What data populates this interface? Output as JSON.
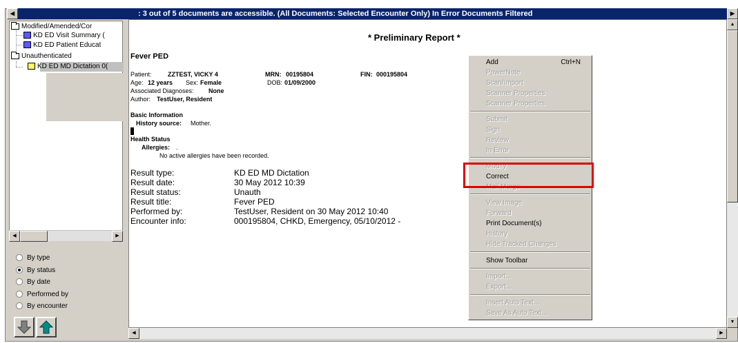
{
  "titlebar": {
    "text": ": 3 out of 5 documents are accessible.  (All Documents: Selected Encounter Only)  In Error Documents Filtered",
    "left_arrow": "◀",
    "right_arrow": "▶"
  },
  "tree": {
    "items": [
      {
        "label": "Modified/Amended/Cor",
        "type": "folder"
      },
      {
        "label": "KD ED Visit Summary (",
        "type": "document"
      },
      {
        "label": "KD ED Patient Educat",
        "type": "document"
      },
      {
        "label": "Unauthenticated",
        "type": "folder"
      },
      {
        "label": "KD ED MD Dictation 0(",
        "type": "document",
        "selected": true
      }
    ]
  },
  "sort_options": {
    "items": [
      {
        "label": "By type",
        "checked": false
      },
      {
        "label": "By status",
        "checked": true
      },
      {
        "label": "By date",
        "checked": false
      },
      {
        "label": "Performed by",
        "checked": false
      },
      {
        "label": "By encounter",
        "checked": false
      }
    ]
  },
  "nav": {
    "down_icon": "down-arrow-icon",
    "up_icon": "up-arrow-icon",
    "down_color": "#808080",
    "up_color": "#008b8b"
  },
  "document": {
    "heading": "* Preliminary Report *",
    "title": "Fever PED",
    "patient_label": "Patient:",
    "patient_value": "ZZTEST, VICKY 4",
    "mrn_label": "MRN:",
    "mrn_value": "00195804",
    "fin_label": "FIN:",
    "fin_value": "000195804",
    "age_label": "Age:",
    "age_value": "12 years",
    "sex_label": "Sex:",
    "sex_value": "Female",
    "dob_label": "DOB:",
    "dob_value": "01/09/2000",
    "dx_label": "Associated Diagnoses:",
    "dx_value": "None",
    "author_label": "Author:",
    "author_value": "TestUser, Resident",
    "basic_info": "Basic Information",
    "history_label": "History source:",
    "history_value": "Mother.",
    "health_status": "Health Status",
    "allergies_label": "Allergies:",
    "allergies_value": ".",
    "allergies_note": "No active allergies have been recorded.",
    "results": [
      {
        "label": "Result type:",
        "value": "KD ED MD Dictation"
      },
      {
        "label": "Result date:",
        "value": "30 May 2012 10:39"
      },
      {
        "label": "Result status:",
        "value": "Unauth"
      },
      {
        "label": "Result title:",
        "value": "Fever PED"
      },
      {
        "label": "Performed by:",
        "value": "TestUser, Resident on 30 May 2012 10:40"
      },
      {
        "label": "Encounter info:",
        "value": "000195804, CHKD, Emergency, 05/10/2012 -"
      }
    ]
  },
  "context_menu": {
    "items": [
      {
        "label": "Add",
        "shortcut": "Ctrl+N",
        "enabled": true
      },
      {
        "label": "PowerNote",
        "enabled": false
      },
      {
        "label": "Scan/Import",
        "enabled": false
      },
      {
        "label": "Scanner Properties",
        "enabled": false
      },
      {
        "label": "Scanner Properties",
        "enabled": false
      },
      {
        "label": "Submit",
        "enabled": false
      },
      {
        "label": "Sign",
        "enabled": false
      },
      {
        "label": "Review",
        "enabled": false
      },
      {
        "label": "In Error",
        "enabled": false
      },
      {
        "label": "Modify",
        "enabled": false
      },
      {
        "label": "Correct",
        "enabled": true
      },
      {
        "label": "Mail Merge",
        "enabled": false
      },
      {
        "label": "View Image",
        "enabled": false
      },
      {
        "label": "Forward",
        "enabled": false
      },
      {
        "label": "Print Document(s)",
        "enabled": true
      },
      {
        "label": "History",
        "enabled": false
      },
      {
        "label": "Hide Tracked Changes",
        "enabled": false
      },
      {
        "label": "Show Toolbar",
        "enabled": true
      },
      {
        "label": "Import...",
        "enabled": false
      },
      {
        "label": "Export...",
        "enabled": false
      },
      {
        "label": "Insert Auto Text...",
        "enabled": false
      },
      {
        "label": "Save As Auto Text...",
        "enabled": false
      }
    ]
  },
  "colors": {
    "titlebar": "#0a246a",
    "highlight": "#e00000",
    "window": "#d4d0c8"
  }
}
